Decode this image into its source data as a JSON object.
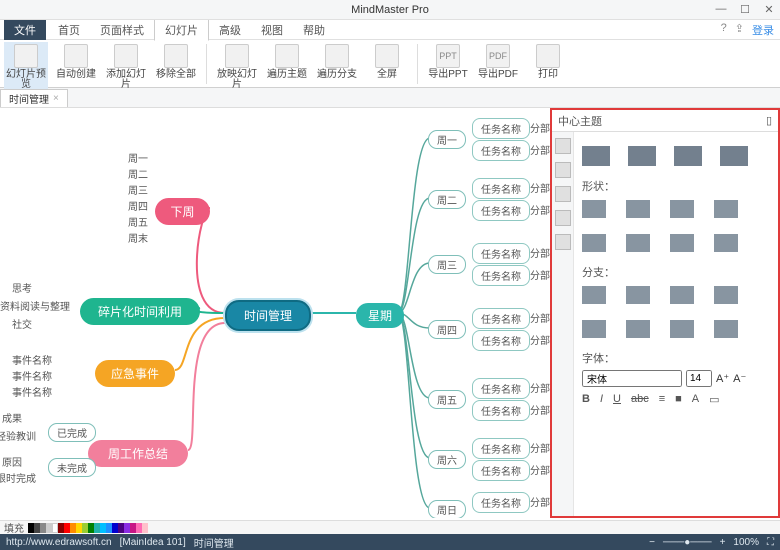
{
  "app": {
    "title": "MindMaster Pro"
  },
  "win": {
    "min": "—",
    "max": "☐",
    "close": "✕"
  },
  "menu": {
    "file": "文件",
    "tabs": [
      "首页",
      "页面样式",
      "幻灯片",
      "高级",
      "视图",
      "帮助"
    ],
    "activeTab": 2,
    "helpIcon": "?",
    "loginIcon": "⇪",
    "login": "登录"
  },
  "ribbon": {
    "items": [
      {
        "label": "幻灯片预览",
        "big": true
      },
      {
        "label": "自动创建"
      },
      {
        "label": "添加幻灯片"
      },
      {
        "label": "移除全部"
      },
      {
        "label": "放映幻灯片",
        "sep_before": true
      },
      {
        "label": "遍历主题"
      },
      {
        "label": "遍历分支"
      },
      {
        "label": "全屏"
      },
      {
        "label": "导出PPT",
        "sep_before": true
      },
      {
        "label": "导出PDF"
      },
      {
        "label": "打印"
      }
    ]
  },
  "doctab": {
    "name": "时间管理",
    "close": "×"
  },
  "mindmap": {
    "central": "时间管理",
    "week": "星期",
    "pink": "下周",
    "green": "碎片化时间利用",
    "orange": "应急事件",
    "pink2": "周工作总结",
    "pink_leaves": [
      "周一",
      "周二",
      "周三",
      "周四",
      "周五",
      "周末"
    ],
    "green_leaves": [
      "思考",
      "资料阅读与整理",
      "社交"
    ],
    "orange_leaves": [
      "事件名称",
      "事件名称",
      "事件名称"
    ],
    "pink2_parts": [
      "已完成",
      "未完成"
    ],
    "pink2_leaves_done": [
      "成果",
      "经验教训"
    ],
    "pink2_leaves_undone": [
      "原因",
      "限时完成"
    ],
    "weekdays": [
      "周一",
      "周二",
      "周三",
      "周四",
      "周五",
      "周六",
      "周日"
    ],
    "task": "任务名称",
    "sub": "分部"
  },
  "panel": {
    "title": "中心主题",
    "pin": "▯",
    "sections": {
      "shape": "形状：",
      "branch": "分支：",
      "font": "字体："
    },
    "fontName": "宋体",
    "fontSize": "14",
    "aPlus": "A⁺",
    "aMinus": "A⁻",
    "fmt": [
      "B",
      "I",
      "U",
      "abc",
      "≡",
      "■",
      "A",
      "▭"
    ]
  },
  "colorbar": {
    "label": "填充"
  },
  "status": {
    "url": "http://www.edrawsoft.cn",
    "doc": "[MainIdea 101]",
    "name": "时间管理",
    "zoomMinus": "−",
    "zoomPlus": "+",
    "zoom": "100%",
    "fit": "⛶"
  }
}
